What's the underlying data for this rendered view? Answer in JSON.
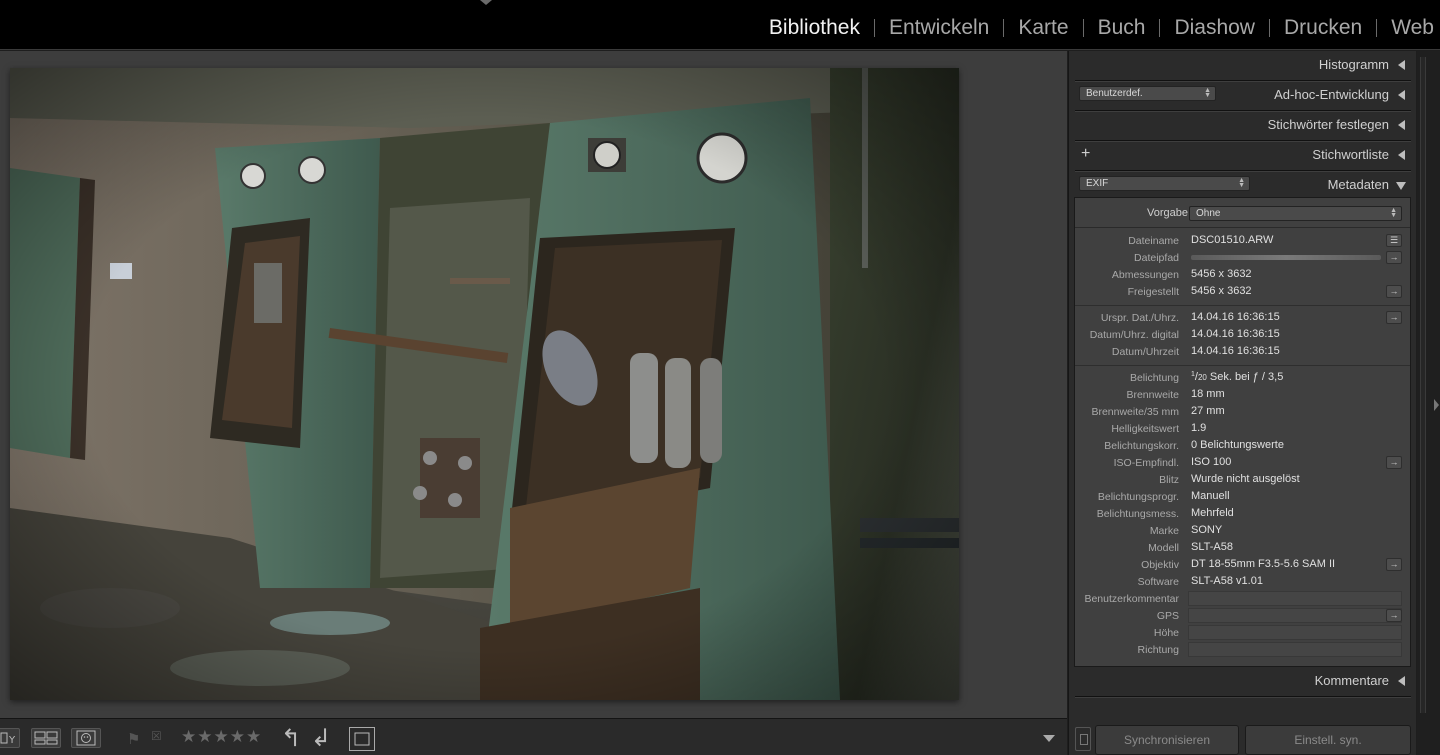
{
  "modules": [
    {
      "label": "Bibliothek",
      "active": true
    },
    {
      "label": "Entwickeln",
      "active": false
    },
    {
      "label": "Karte",
      "active": false
    },
    {
      "label": "Buch",
      "active": false
    },
    {
      "label": "Diashow",
      "active": false
    },
    {
      "label": "Drucken",
      "active": false
    },
    {
      "label": "Web",
      "active": false
    }
  ],
  "panels": {
    "histogram": "Histogramm",
    "quick_develop": "Ad-hoc-Entwicklung",
    "quick_develop_preset": "Benutzerdef.",
    "keywording": "Stichwörter festlegen",
    "keyword_list": "Stichwortliste",
    "metadata": "Metadaten",
    "metadata_set": "EXIF",
    "comments": "Kommentare"
  },
  "metadata": {
    "preset_label": "Vorgabe",
    "preset_value": "Ohne",
    "file": [
      {
        "key": "Dateiname",
        "value": "DSC01510.ARW"
      },
      {
        "key": "Dateipfad",
        "value": ""
      },
      {
        "key": "Abmessungen",
        "value": "5456 x 3632"
      },
      {
        "key": "Freigestellt",
        "value": "5456 x 3632"
      }
    ],
    "dates": [
      {
        "key": "Urspr. Dat./Uhrz.",
        "value": "14.04.16 16:36:15"
      },
      {
        "key": "Datum/Uhrz. digital",
        "value": "14.04.16 16:36:15"
      },
      {
        "key": "Datum/Uhrzeit",
        "value": "14.04.16 16:36:15"
      }
    ],
    "exposure": {
      "key": "Belichtung",
      "num": "1",
      "den": "20",
      "rest": " Sek. bei ƒ / 3,5"
    },
    "exif": [
      {
        "key": "Brennweite",
        "value": "18 mm"
      },
      {
        "key": "Brennweite/35 mm",
        "value": "27 mm"
      },
      {
        "key": "Helligkeitswert",
        "value": "1.9"
      },
      {
        "key": "Belichtungskorr.",
        "value": "0 Belichtungswerte"
      },
      {
        "key": "ISO-Empfindl.",
        "value": "ISO 100"
      },
      {
        "key": "Blitz",
        "value": "Wurde nicht ausgelöst"
      },
      {
        "key": "Belichtungsprogr.",
        "value": "Manuell"
      },
      {
        "key": "Belichtungsmess.",
        "value": "Mehrfeld"
      },
      {
        "key": "Marke",
        "value": "SONY"
      },
      {
        "key": "Modell",
        "value": "SLT-A58"
      },
      {
        "key": "Objektiv",
        "value": "DT 18-55mm F3.5-5.6 SAM II"
      },
      {
        "key": "Software",
        "value": "SLT-A58 v1.01"
      },
      {
        "key": "Benutzerkommentar",
        "value": ""
      },
      {
        "key": "GPS",
        "value": ""
      },
      {
        "key": "Höhe",
        "value": ""
      },
      {
        "key": "Richtung",
        "value": ""
      }
    ]
  },
  "buttons": {
    "sync": "Synchronisieren",
    "sync_settings": "Einstell. syn."
  },
  "toolbar": {
    "stars": "★★★★★",
    "rating": 0
  }
}
